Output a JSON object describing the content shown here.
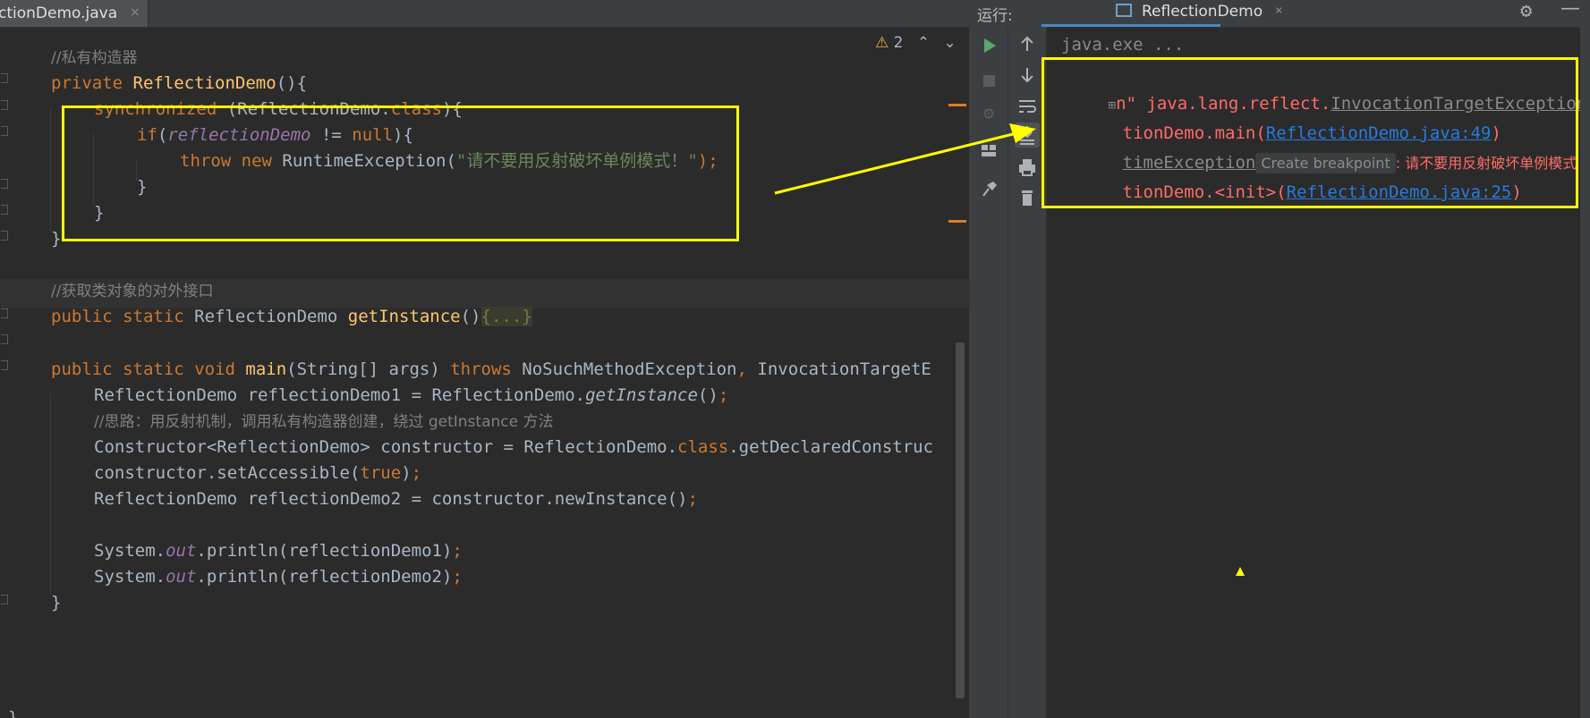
{
  "editor": {
    "tab_label": "ctionDemo.java",
    "tab_close": "×",
    "problems_count": "2",
    "warn_glyph": "⚠",
    "lines": {
      "l1_comment": "//私有构造器",
      "l2_private": "private",
      "l2_ctor": "ReflectionDemo",
      "l2_rest": "(){",
      "l3_sync": "synchronized",
      "l3_a": " (ReflectionDemo.",
      "l3_class": "class",
      "l3_b": "){",
      "l4_if": "if",
      "l4_a": "(",
      "l4_field": "reflectionDemo",
      "l4_b": " != ",
      "l4_null": "null",
      "l4_c": "){",
      "l5_throw": "throw",
      "l5_new": "new",
      "l5_type": " RuntimeException(",
      "l5_str": "\"请不要用反射破坏单例模式！\"",
      "l5_end": ");",
      "l6": "}",
      "l7": "}",
      "l8": "}",
      "l9_comment": "//获取类对象的对外接口",
      "l10_public": "public",
      "l10_static": "static",
      "l10_type": " ReflectionDemo ",
      "l10_fn": "getInstance",
      "l10_paren": "()",
      "l10_body": "{...}",
      "l11_public": "public",
      "l11_static": "static",
      "l11_void": "void",
      "l11_fn": "main",
      "l11_args": "(String[] args) ",
      "l11_throws": "throws",
      "l11_ex1": " NoSuchMethodException",
      "l11_comma": ",",
      "l11_ex2": " InvocationTargetE",
      "l12_a": "ReflectionDemo reflectionDemo1 = ReflectionDemo.",
      "l12_m": "getInstance",
      "l12_b": "()",
      "l12_semi": ";",
      "l13_comment": "//思路：用反射机制，调用私有构造器创建，绕过 getInstance 方法",
      "l14_a": "Constructor<ReflectionDemo> constructor = ReflectionDemo.",
      "l14_class": "class",
      "l14_b": ".getDeclaredConstruc",
      "l15_a": "constructor.setAccessible(",
      "l15_true": "true",
      "l15_b": ")",
      "l15_semi": ";",
      "l16_a": "ReflectionDemo reflectionDemo2 = constructor.newInstance()",
      "l16_semi": ";",
      "l17_a": "System.",
      "l17_out": "out",
      "l17_b": ".println(reflectionDemo1)",
      "l17_semi": ";",
      "l18_a": "System.",
      "l18_out": "out",
      "l18_b": ".println(reflectionDemo2)",
      "l18_semi": ";",
      "l19": "}",
      "l20": "}"
    }
  },
  "run_panel": {
    "label": "运行:",
    "tab_title": "ReflectionDemo",
    "tab_close": "×",
    "console": {
      "line0": "java.exe ...",
      "line1_a": "n\" java.lang.reflect.",
      "line1_link": "InvocationTargetException",
      "line1_b": " <",
      "line2_a": "tionDemo.main(",
      "line2_link": "ReflectionDemo.java:49",
      "line2_b": ")",
      "line3_a": "timeException",
      "line3_tip": "Create breakpoint",
      "line3_b": ": 请不要用反射破坏单例模式",
      "line4_a": "tionDemo.<init>(",
      "line4_link": "ReflectionDemo.java:25",
      "line4_b": ")"
    }
  },
  "colors": {
    "highlight_box": "#ffff00",
    "keyword": "#cc7832",
    "error_text": "#ff6b68",
    "link": "#287bde"
  },
  "icons": [
    "run-icon",
    "stop-icon",
    "settings-icon",
    "layout-icon",
    "pin-icon",
    "up-arrow-icon",
    "down-arrow-icon",
    "soft-wrap-icon",
    "scroll-to-end-icon",
    "print-icon",
    "trash-icon",
    "gear-icon",
    "minimize-icon",
    "caret-up-icon",
    "caret-down-icon",
    "warning-icon",
    "expand-icon"
  ]
}
